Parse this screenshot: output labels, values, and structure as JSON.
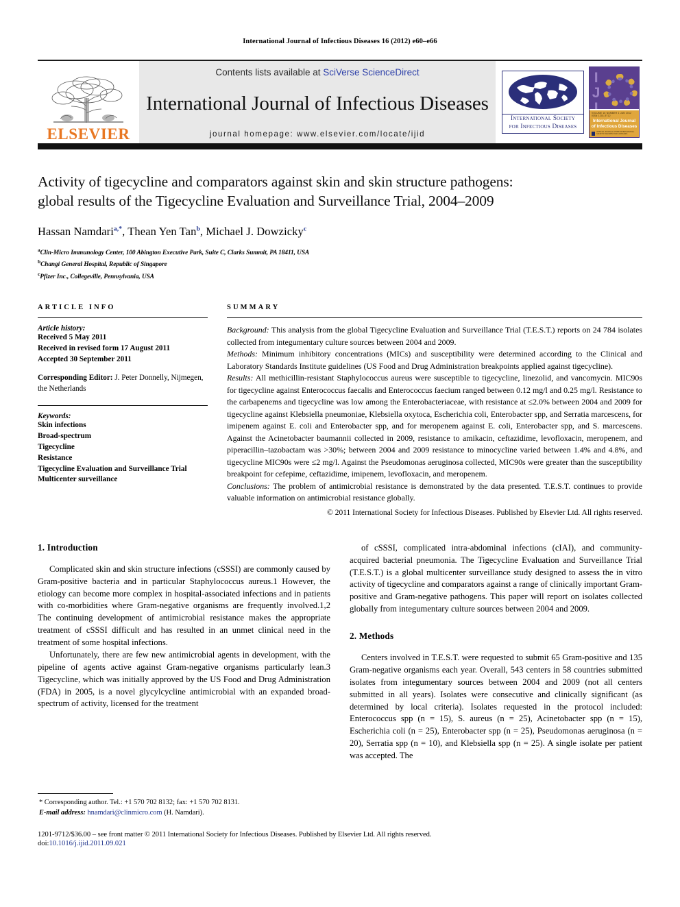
{
  "running_head": "International Journal of Infectious Diseases 16 (2012) e60–e66",
  "masthead": {
    "contents_prefix": "Contents lists available at ",
    "sciencedirect": "SciVerse ScienceDirect",
    "journal_name": "International Journal of Infectious Diseases",
    "homepage": "journal homepage: www.elsevier.com/locate/ijid",
    "elsevier_wordmark": "ELSEVIER",
    "isid_line1": "International Society",
    "isid_line2": "for Infectious Diseases",
    "cover_ijid": "IJID",
    "cover_title_line1": "International Journal",
    "cover_title_line2": "of Infectious Diseases",
    "cover_band_top": "VOLUME 16   NUMBER 1   JAN 2012   ISSN 1201-9712",
    "cover_band_foot": "OFFICIAL JOURNAL OF THE INTERNATIONAL SOCIETY FOR INFECTIOUS DISEASES"
  },
  "article": {
    "title_line1": "Activity of tigecycline and comparators against skin and skin structure pathogens:",
    "title_line2": "global results of the Tigecycline Evaluation and Surveillance Trial, 2004–2009",
    "authors": [
      {
        "name": "Hassan Namdari",
        "marks": "a,*"
      },
      {
        "name": "Thean Yen Tan",
        "marks": "b"
      },
      {
        "name": "Michael J. Dowzicky",
        "marks": "c"
      }
    ],
    "affiliations": [
      {
        "mark": "a",
        "text": "Clin-Micro Immunology Center, 100 Abington Executive Park, Suite C, Clarks Summit, PA 18411, USA"
      },
      {
        "mark": "b",
        "text": "Changi General Hospital, Republic of Singapore"
      },
      {
        "mark": "c",
        "text": "Pfizer Inc., Collegeville, Pennsylvania, USA"
      }
    ]
  },
  "article_info": {
    "heading": "ARTICLE INFO",
    "history_label": "Article history:",
    "history": [
      "Received 5 May 2011",
      "Received in revised form 17 August 2011",
      "Accepted 30 September 2011"
    ],
    "corresponding_editor_label": "Corresponding Editor:",
    "corresponding_editor_value": " J. Peter Donnelly, Nijmegen, the Netherlands",
    "keywords_label": "Keywords:",
    "keywords": [
      "Skin infections",
      "Broad-spectrum",
      "Tigecycline",
      "Resistance",
      "Tigecycline Evaluation and Surveillance Trial",
      "Multicenter surveillance"
    ]
  },
  "summary": {
    "heading": "SUMMARY",
    "background_label": "Background:",
    "background_text": " This analysis from the global Tigecycline Evaluation and Surveillance Trial (T.E.S.T.) reports on 24 784 isolates collected from integumentary culture sources between 2004 and 2009.",
    "methods_label": "Methods:",
    "methods_text": " Minimum inhibitory concentrations (MICs) and susceptibility were determined according to the Clinical and Laboratory Standards Institute guidelines (US Food and Drug Administration breakpoints applied against tigecycline).",
    "results_label": "Results:",
    "results_text": " All methicillin-resistant Staphylococcus aureus were susceptible to tigecycline, linezolid, and vancomycin. MIC90s for tigecycline against Enterococcus faecalis and Enterococcus faecium ranged between 0.12 mg/l and 0.25 mg/l. Resistance to the carbapenems and tigecycline was low among the Enterobacteriaceae, with resistance at ≤2.0% between 2004 and 2009 for tigecycline against Klebsiella pneumoniae, Klebsiella oxytoca, Escherichia coli, Enterobacter spp, and Serratia marcescens, for imipenem against E. coli and Enterobacter spp, and for meropenem against E. coli, Enterobacter spp, and S. marcescens. Against the Acinetobacter baumannii collected in 2009, resistance to amikacin, ceftazidime, levofloxacin, meropenem, and piperacillin–tazobactam was >30%; between 2004 and 2009 resistance to minocycline varied between 1.4% and 4.8%, and tigecycline MIC90s were ≤2 mg/l. Against the Pseudomonas aeruginosa collected, MIC90s were greater than the susceptibility breakpoint for cefepime, ceftazidime, imipenem, levofloxacin, and meropenem.",
    "conclusions_label": "Conclusions:",
    "conclusions_text": " The problem of antimicrobial resistance is demonstrated by the data presented. T.E.S.T. continues to provide valuable information on antimicrobial resistance globally.",
    "copyright": "© 2011 International Society for Infectious Diseases. Published by Elsevier Ltd. All rights reserved."
  },
  "body": {
    "intro_heading": "1. Introduction",
    "intro_p1": "Complicated skin and skin structure infections (cSSSI) are commonly caused by Gram-positive bacteria and in particular Staphylococcus aureus.1 However, the etiology can become more complex in hospital-associated infections and in patients with co-morbidities where Gram-negative organisms are frequently involved.1,2 The continuing development of antimicrobial resistance makes the appropriate treatment of cSSSI difficult and has resulted in an unmet clinical need in the treatment of some hospital infections.",
    "intro_p2": "Unfortunately, there are few new antimicrobial agents in development, with the pipeline of agents active against Gram-negative organisms particularly lean.3 Tigecycline, which was initially approved by the US Food and Drug Administration (FDA) in 2005, is a novel glycylcycline antimicrobial with an expanded broad-spectrum of activity, licensed for the treatment",
    "intro_p3": "of cSSSI, complicated intra-abdominal infections (cIAI), and community-acquired bacterial pneumonia. The Tigecycline Evaluation and Surveillance Trial (T.E.S.T.) is a global multicenter surveillance study designed to assess the in vitro activity of tigecycline and comparators against a range of clinically important Gram-positive and Gram-negative pathogens. This paper will report on isolates collected globally from integumentary culture sources between 2004 and 2009.",
    "methods_heading": "2. Methods",
    "methods_p1": "Centers involved in T.E.S.T. were requested to submit 65 Gram-positive and 135 Gram-negative organisms each year. Overall, 543 centers in 58 countries submitted isolates from integumentary sources between 2004 and 2009 (not all centers submitted in all years). Isolates were consecutive and clinically significant (as determined by local criteria). Isolates requested in the protocol included: Enterococcus spp (n = 15), S. aureus (n = 25), Acinetobacter spp (n = 15), Escherichia coli (n = 25), Enterobacter spp (n = 25), Pseudomonas aeruginosa (n = 20), Serratia spp (n = 10), and Klebsiella spp (n = 25). A single isolate per patient was accepted. The"
  },
  "footnote": {
    "corresponding": "* Corresponding author. Tel.: +1 570 702 8132; fax: +1 570 702 8131.",
    "email_label": "E-mail address:",
    "email": "hnamdari@clinmicro.com",
    "email_suffix": " (H. Namdari)."
  },
  "bottom": {
    "frontmatter": "1201-9712/$36.00 – see front matter © 2011 International Society for Infectious Diseases. Published by Elsevier Ltd. All rights reserved.",
    "doi_label": "doi:",
    "doi_value": "10.1016/j.ijid.2011.09.021"
  },
  "colors": {
    "elsevier_orange": "#E87722",
    "link_blue": "#1a2f8a",
    "panel_gray": "#e8e8e8",
    "rule_dark": "#111111"
  }
}
